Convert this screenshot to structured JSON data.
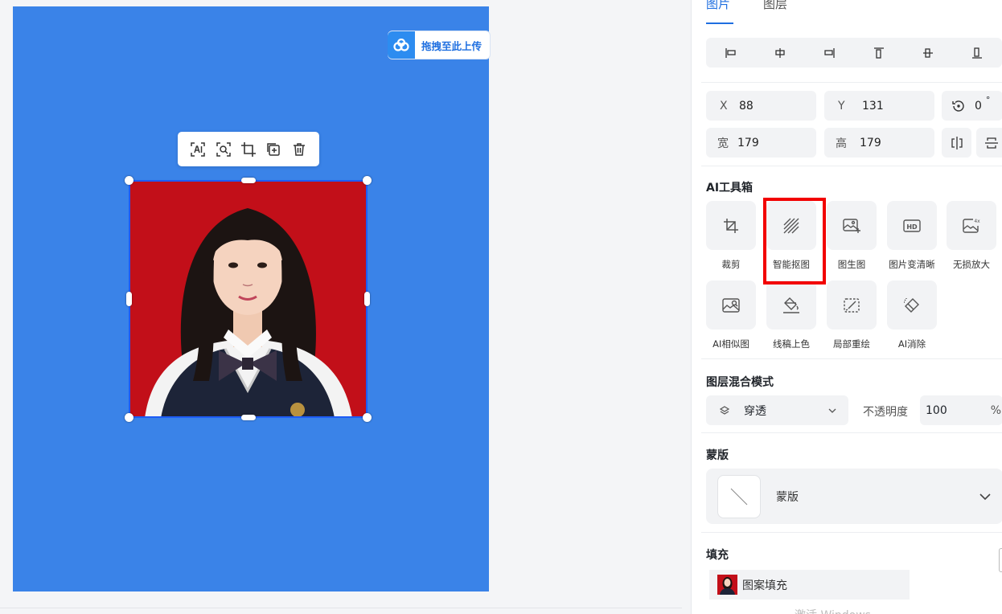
{
  "canvas": {
    "upload_button": "拖拽至此上传",
    "toolbar_icons": [
      "ai-text-icon",
      "image-search-icon",
      "crop-icon",
      "copy-icon",
      "trash-icon"
    ]
  },
  "panel": {
    "tabs": [
      {
        "label": "图片",
        "active": true
      },
      {
        "label": "图层",
        "active": false
      }
    ],
    "align_icons": [
      "align-left-icon",
      "align-hcenter-icon",
      "align-right-icon",
      "align-top-icon",
      "align-vcenter-icon",
      "align-bottom-icon"
    ],
    "geometry": {
      "x_label": "X",
      "x_value": "88",
      "y_label": "Y",
      "y_value": "131",
      "rotation_value": "0",
      "rotation_unit": "°",
      "w_label": "宽",
      "w_value": "179",
      "h_label": "高",
      "h_value": "179"
    },
    "ai_toolbox": {
      "title": "AI工具箱",
      "tools": [
        {
          "label": "裁剪",
          "icon": "crop-icon"
        },
        {
          "label": "智能抠图",
          "icon": "cutout-icon",
          "highlighted": true
        },
        {
          "label": "图生图",
          "icon": "image-to-image-icon"
        },
        {
          "label": "图片变清晰",
          "icon": "hd-icon"
        },
        {
          "label": "无损放大",
          "icon": "upscale-4x-icon"
        },
        {
          "label": "AI相似图",
          "icon": "similar-image-icon"
        },
        {
          "label": "线稿上色",
          "icon": "paint-bucket-icon"
        },
        {
          "label": "局部重绘",
          "icon": "partial-redraw-icon"
        },
        {
          "label": "AI消除",
          "icon": "eraser-icon"
        }
      ]
    },
    "blend": {
      "title": "图层混合模式",
      "mode": "穿透",
      "opacity_label": "不透明度",
      "opacity_value": "100",
      "opacity_unit": "%"
    },
    "mask": {
      "title": "蒙版",
      "label": "蒙版"
    },
    "fill": {
      "title": "填充",
      "label": "图案填充"
    },
    "watermark": "激活 Windows"
  },
  "colors": {
    "artboard": "#3a83e8",
    "accent": "#1f6fe0",
    "highlight": "#f20000",
    "photo_bg": "#c4101a"
  }
}
